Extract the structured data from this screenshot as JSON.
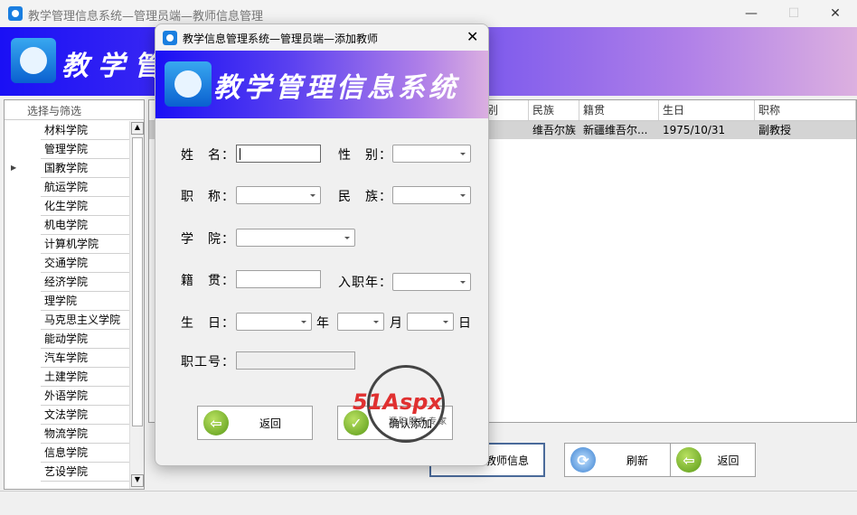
{
  "main_window": {
    "title": "教学管理信息系统—管理员端—教师信息管理",
    "banner_title": "教学管理信息系统"
  },
  "filter_panel": {
    "header": "选择与筛选",
    "items": [
      "材料学院",
      "管理学院",
      "国教学院",
      "航运学院",
      "化生学院",
      "机电学院",
      "计算机学院",
      "交通学院",
      "经济学院",
      "理学院",
      "马克思主义学院",
      "能动学院",
      "汽车学院",
      "土建学院",
      "外语学院",
      "文法学院",
      "物流学院",
      "信息学院",
      "艺设学院"
    ]
  },
  "grid": {
    "columns": [
      "别",
      "民族",
      "籍贯",
      "生日",
      "职称"
    ],
    "row": [
      "",
      "维吾尔族",
      "新疆维吾尔...",
      "1975/10/31",
      "副教授"
    ]
  },
  "bottom_buttons": {
    "add": "添加教师信息",
    "refresh": "刷新",
    "back": "返回"
  },
  "dialog": {
    "title": "教学信息管理系统—管理员端—添加教师",
    "banner_title": "教学管理信息系统",
    "labels": {
      "name": "姓　名：",
      "gender": "性　别：",
      "title": "职　称：",
      "ethnicity": "民　族：",
      "college": "学　院：",
      "native": "籍　贯：",
      "entry_year": "入职年：",
      "birthday": "生　日：",
      "year": "年",
      "month": "月",
      "day": "日",
      "staff_id": "职工号："
    },
    "values": {
      "name": "",
      "staff_id": ""
    },
    "buttons": {
      "back": "返回",
      "confirm": "确认添加"
    }
  },
  "watermark": {
    "brand": "51Aspx",
    "slogan": "源码服务专家"
  }
}
